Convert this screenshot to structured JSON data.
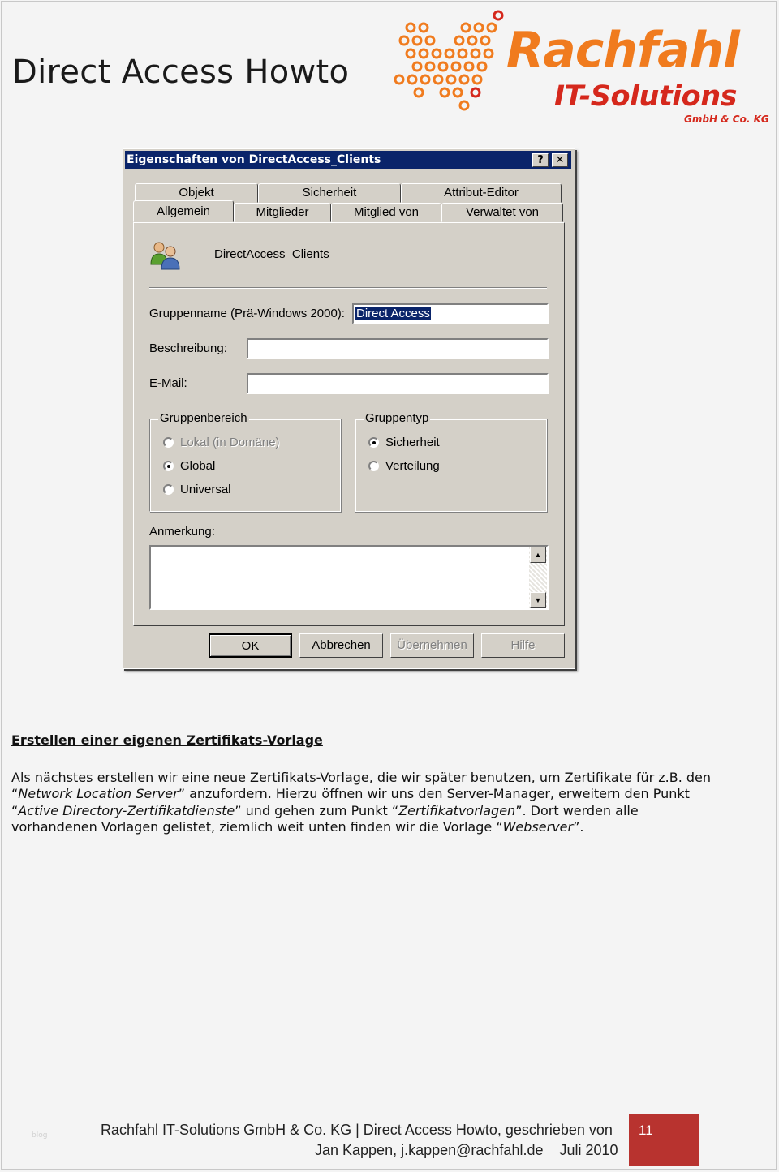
{
  "document": {
    "title": "Direct Access Howto",
    "logo": {
      "name": "Rachfahl",
      "subtitle": "IT-Solutions",
      "company_form": "GmbH & Co. KG",
      "brand_orange": "#f07b1e",
      "brand_red": "#d5281c"
    }
  },
  "dialog": {
    "title": "Eigenschaften von DirectAccess_Clients",
    "help_button": "?",
    "close_button": "✕",
    "tabs_row1": [
      "Objekt",
      "Sicherheit",
      "Attribut-Editor"
    ],
    "tabs_row2": [
      "Allgemein",
      "Mitglieder",
      "Mitglied von",
      "Verwaltet von"
    ],
    "active_tab": "Allgemein",
    "group_icon": "users-icon",
    "object_name": "DirectAccess_Clients",
    "fields": {
      "pre2000_label": "Gruppenname (Prä-Windows 2000):",
      "pre2000_value": "Direct Access",
      "description_label": "Beschreibung:",
      "description_value": "",
      "email_label": "E-Mail:",
      "email_value": ""
    },
    "scope": {
      "title": "Gruppenbereich",
      "options": [
        "Lokal (in Domäne)",
        "Global",
        "Universal"
      ],
      "selected": "Global"
    },
    "type": {
      "title": "Gruppentyp",
      "options": [
        "Sicherheit",
        "Verteilung"
      ],
      "selected": "Sicherheit"
    },
    "notes_label": "Anmerkung:",
    "buttons": [
      "OK",
      "Abbrechen",
      "Übernehmen",
      "Hilfe"
    ]
  },
  "section": {
    "heading": "Erstellen einer eigenen Zertifikats-Vorlage",
    "p1": "Als nächstes erstellen wir eine neue Zertifikats-Vorlage, die wir später benutzen, um Zertifikate für z.B. den “",
    "p1_em": "Network Location Server",
    "p2": "” anzufordern. Hierzu öffnen wir uns den Server-Manager, erweitern den Punkt “",
    "p2_em": "Active Directory-Zertifikatdienste",
    "p3": "” und gehen zum Punkt “",
    "p3_em": "Zertifikatvorlagen",
    "p4": "”. Dort werden alle vorhandenen Vorlagen gelistet, ziemlich weit unten finden wir die Vorlage “",
    "p4_em": "Webserver",
    "p5": "”."
  },
  "footer": {
    "ghost": "blog",
    "line1": "Rachfahl IT-Solutions GmbH & Co. KG | Direct Access Howto, geschrieben von",
    "line2": "Jan Kappen, j.kappen@rachfahl.de    Juli 2010",
    "page": "11",
    "page_box_color": "#b8332f"
  }
}
